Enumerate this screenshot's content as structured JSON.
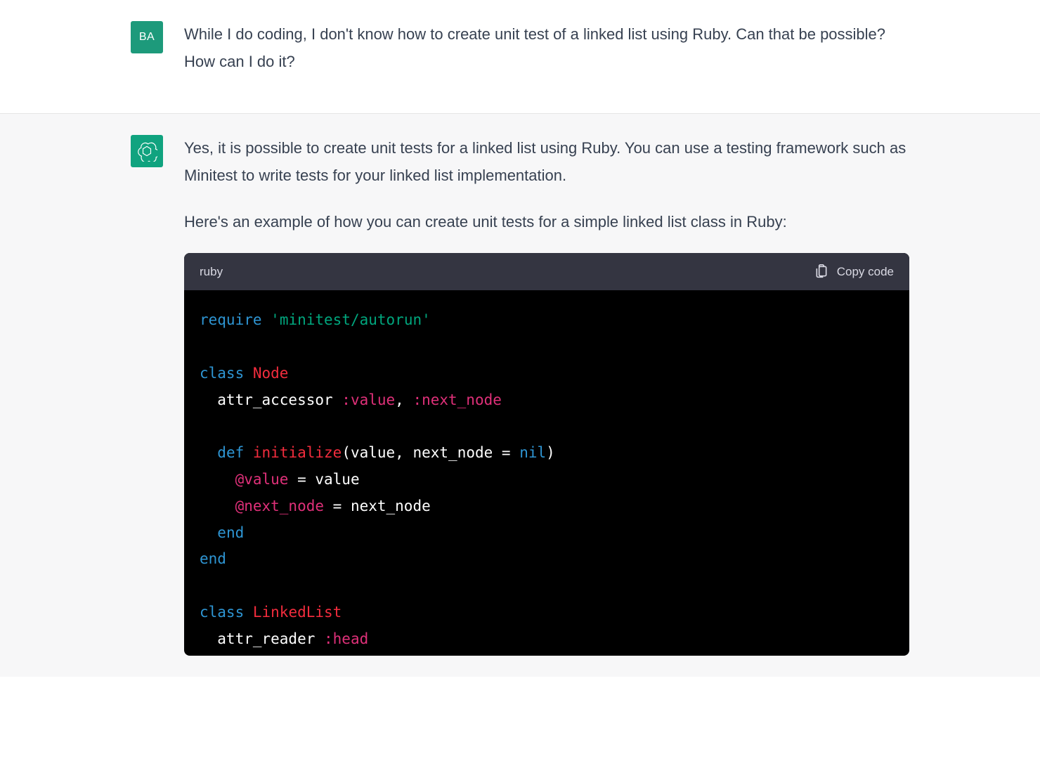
{
  "user": {
    "avatar_initials": "BA",
    "message": "While I do coding, I don't know how to create unit test of a linked list using Ruby. Can that be possible? How can I do it?"
  },
  "assistant": {
    "paragraph1": "Yes, it is possible to create unit tests for a linked list using Ruby. You can use a testing framework such as Minitest to write tests for your linked list implementation.",
    "paragraph2": "Here's an example of how you can create unit tests for a simple linked list class in Ruby:",
    "code": {
      "language": "ruby",
      "copy_label": "Copy code",
      "tokens": [
        [
          [
            "kw",
            "require"
          ],
          [
            "pl",
            " "
          ],
          [
            "str",
            "'minitest/autorun'"
          ]
        ],
        [],
        [
          [
            "kw",
            "class"
          ],
          [
            "pl",
            " "
          ],
          [
            "fn",
            "Node"
          ]
        ],
        [
          [
            "pl",
            "  attr_accessor "
          ],
          [
            "sym",
            ":value"
          ],
          [
            "pl",
            ", "
          ],
          [
            "sym",
            ":next_node"
          ]
        ],
        [],
        [
          [
            "pl",
            "  "
          ],
          [
            "kw",
            "def"
          ],
          [
            "pl",
            " "
          ],
          [
            "fn",
            "initialize"
          ],
          [
            "pl",
            "(value, next_node = "
          ],
          [
            "nil",
            "nil"
          ],
          [
            "pl",
            ")"
          ]
        ],
        [
          [
            "pl",
            "    "
          ],
          [
            "ivar",
            "@value"
          ],
          [
            "pl",
            " = value"
          ]
        ],
        [
          [
            "pl",
            "    "
          ],
          [
            "ivar",
            "@next_node"
          ],
          [
            "pl",
            " = next_node"
          ]
        ],
        [
          [
            "pl",
            "  "
          ],
          [
            "kw",
            "end"
          ]
        ],
        [
          [
            "kw",
            "end"
          ]
        ],
        [],
        [
          [
            "kw",
            "class"
          ],
          [
            "pl",
            " "
          ],
          [
            "fn",
            "LinkedList"
          ]
        ],
        [
          [
            "pl",
            "  attr_reader "
          ],
          [
            "sym",
            ":head"
          ]
        ]
      ]
    }
  }
}
